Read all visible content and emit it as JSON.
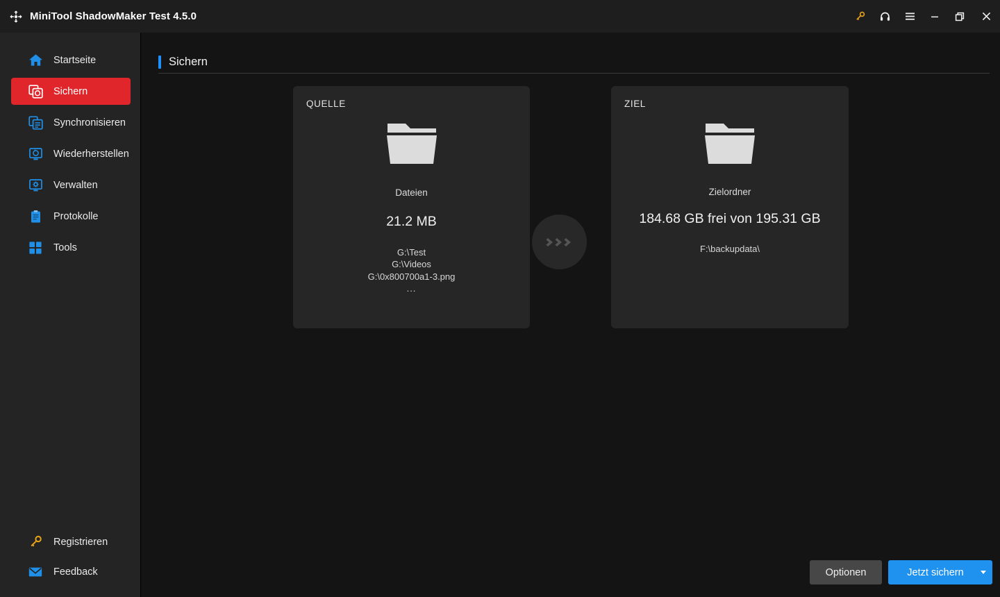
{
  "window": {
    "title": "MiniTool ShadowMaker Test 4.5.0",
    "logo_icon": "refresh-arrows-logo",
    "controls": [
      {
        "name": "key-icon",
        "label": ""
      },
      {
        "name": "headset-icon",
        "label": ""
      },
      {
        "name": "hamburger-icon",
        "label": ""
      },
      {
        "name": "minimize-icon",
        "label": ""
      },
      {
        "name": "restore-icon",
        "label": ""
      },
      {
        "name": "close-icon",
        "label": ""
      }
    ]
  },
  "sidebar": {
    "items": [
      {
        "label": "Startseite",
        "icon": "home-icon",
        "active": false
      },
      {
        "label": "Sichern",
        "icon": "backup-icon",
        "active": true
      },
      {
        "label": "Synchronisieren",
        "icon": "sync-icon",
        "active": false
      },
      {
        "label": "Wiederherstellen",
        "icon": "restore-disk-icon",
        "active": false
      },
      {
        "label": "Verwalten",
        "icon": "manage-icon",
        "active": false
      },
      {
        "label": "Protokolle",
        "icon": "logs-icon",
        "active": false
      },
      {
        "label": "Tools",
        "icon": "tools-grid-icon",
        "active": false
      }
    ],
    "bottom_items": [
      {
        "label": "Registrieren",
        "icon": "key-icon"
      },
      {
        "label": "Feedback",
        "icon": "mail-icon"
      }
    ]
  },
  "page": {
    "title": "Sichern",
    "accent_color": "#1e90ff"
  },
  "source_panel": {
    "label": "QUELLE",
    "icon": "folder-icon",
    "kind": "Dateien",
    "size": "21.2 MB",
    "paths": [
      "G:\\Test",
      "G:\\Videos",
      "G:\\0x800700a1-3.png"
    ],
    "paths_overflow": "..."
  },
  "connector": {
    "icon": "chevrons-right-icon"
  },
  "dest_panel": {
    "label": "ZIEL",
    "icon": "folder-icon",
    "kind": "Zielordner",
    "capacity": "184.68 GB frei von 195.31 GB",
    "path": "F:\\backupdata\\"
  },
  "footer": {
    "options_label": "Optionen",
    "backup_label": "Jetzt sichern",
    "dropdown_icon": "caret-down-icon",
    "backup_color": "#1f92f0",
    "options_color": "#474747"
  },
  "theme": {
    "titlebar_bg": "#1e1e1e",
    "sidebar_bg": "#242424",
    "content_bg": "#141414",
    "panel_bg": "#262626",
    "active_nav_bg": "#e0262b",
    "folder_color": "#dcdcdc",
    "key_color": "#e8a317"
  }
}
